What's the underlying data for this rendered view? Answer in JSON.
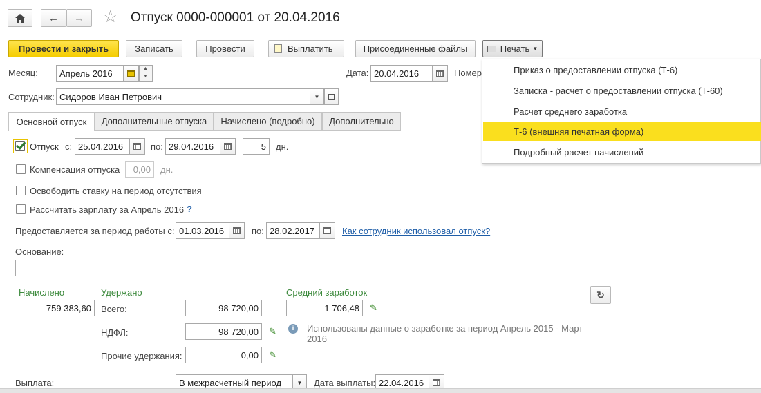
{
  "title": "Отпуск 0000-000001 от 20.04.2016",
  "toolbar": {
    "post_close": "Провести и закрыть",
    "save": "Записать",
    "post": "Провести",
    "pay": "Выплатить",
    "attached": "Присоединенные файлы",
    "print": "Печать"
  },
  "header": {
    "month_label": "Месяц:",
    "month_value": "Апрель 2016",
    "date_label": "Дата:",
    "date_value": "20.04.2016",
    "number_label": "Номер:",
    "employee_label": "Сотрудник:",
    "employee_value": "Сидоров Иван Петрович"
  },
  "tabs": [
    "Основной отпуск",
    "Дополнительные отпуска",
    "Начислено (подробно)",
    "Дополнительно"
  ],
  "main": {
    "leave_label": "Отпуск",
    "from_label": "с:",
    "from_value": "25.04.2016",
    "to_label": "по:",
    "to_value": "29.04.2016",
    "days_value": "5",
    "days_unit": "дн.",
    "compensation_label": "Компенсация отпуска",
    "compensation_value": "0,00",
    "compensation_unit": "дн.",
    "release_rate_label": "Освободить ставку на период отсутствия",
    "calc_salary_label": "Рассчитать зарплату за Апрель 2016",
    "help_mark": "?",
    "period_label": "Предоставляется за период работы с:",
    "period_from": "01.03.2016",
    "period_to_label": "по:",
    "period_to": "28.02.2017",
    "usage_link": "Как сотрудник использовал отпуск?",
    "basis_label": "Основание:",
    "basis_value": "",
    "accrued_label": "Начислено",
    "accrued_value": "759 383,60",
    "withheld_label": "Удержано",
    "total_label": "Всего:",
    "total_value": "98 720,00",
    "ndfl_label": "НДФЛ:",
    "ndfl_value": "98 720,00",
    "other_label": "Прочие удержания:",
    "other_value": "0,00",
    "avg_label": "Средний заработок",
    "avg_value": "1 706,48",
    "info_text": "Использованы данные о заработке за период Апрель 2015 - Март 2016",
    "payout_label": "Выплата:",
    "payout_value": "В межрасчетный период",
    "payout_date_label": "Дата выплаты:",
    "payout_date_value": "22.04.2016"
  },
  "print_menu": [
    "Приказ о предоставлении отпуска (Т-6)",
    "Записка - расчет о предоставлении отпуска (Т-60)",
    "Расчет среднего заработка",
    "Т-6 (внешняя печатная форма)",
    "Подробный расчет начислений"
  ],
  "colors": {
    "accent": "#f5cd00",
    "highlight": "#fadf1e",
    "green_label": "#3d8a3d",
    "link": "#1f5ea8"
  }
}
